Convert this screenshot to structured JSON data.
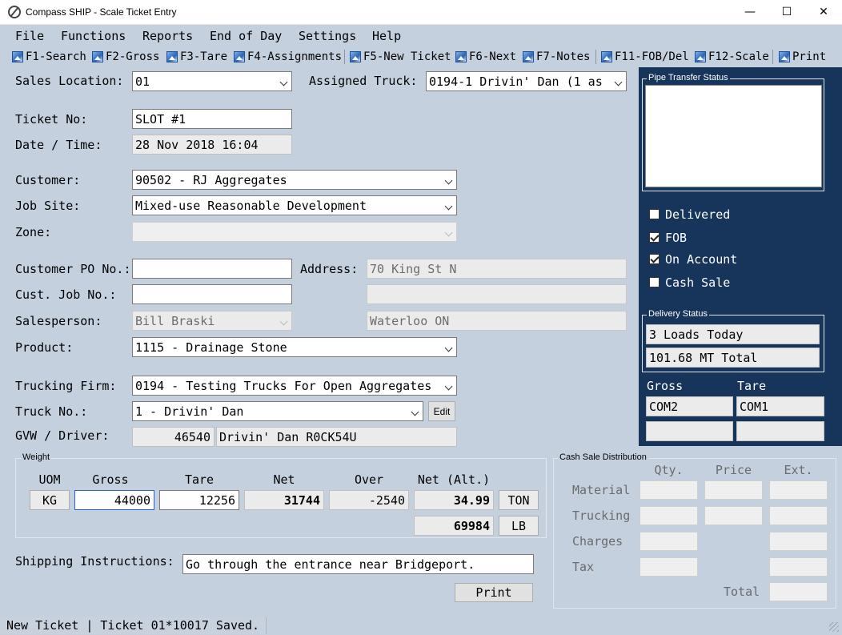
{
  "window": {
    "title": "Compass SHIP - Scale Ticket Entry",
    "minimize": "—",
    "maximize": "☐",
    "close": "✕"
  },
  "menu": [
    "File",
    "Functions",
    "Reports",
    "End of Day",
    "Settings",
    "Help"
  ],
  "toolbar": [
    "F1-Search",
    "F2-Gross",
    "F3-Tare",
    "F4-Assignments",
    "F5-New Ticket",
    "F6-Next",
    "F7-Notes",
    "F11-FOB/Del",
    "F12-Scale",
    "Print"
  ],
  "form": {
    "sales_location": {
      "label": "Sales Location:",
      "value": "01"
    },
    "assigned_truck": {
      "label": "Assigned Truck:",
      "value": "0194-1 Drivin' Dan  (1 as"
    },
    "ticket_no": {
      "label": "Ticket No:",
      "value": "SLOT #1"
    },
    "date_time": {
      "label": "Date / Time:",
      "value": "28 Nov 2018 16:04"
    },
    "customer": {
      "label": "Customer:",
      "value": "90502 - RJ Aggregates"
    },
    "job_site": {
      "label": "Job Site:",
      "value": "Mixed-use Reasonable Development"
    },
    "zone": {
      "label": "Zone:",
      "value": ""
    },
    "customer_po": {
      "label": "Customer PO No.:",
      "value": ""
    },
    "address": {
      "label": "Address:",
      "line1": "70 King St N",
      "line2": "",
      "line3": "Waterloo ON"
    },
    "cust_job_no": {
      "label": "Cust. Job No.:",
      "value": ""
    },
    "salesperson": {
      "label": "Salesperson:",
      "value": "Bill Braski"
    },
    "product": {
      "label": "Product:",
      "value": "1115 - Drainage Stone"
    },
    "trucking_firm": {
      "label": "Trucking Firm:",
      "value": "0194 - Testing Trucks For Open Aggregates"
    },
    "truck_no": {
      "label": "Truck No.:",
      "value": "1 - Drivin' Dan",
      "edit_label": "Edit"
    },
    "gvw_driver": {
      "label": "GVW / Driver:",
      "gvw": "46540",
      "driver": "Drivin' Dan R0CK54U"
    },
    "shipping_instructions": {
      "label": "Shipping Instructions:",
      "value": "Go through the entrance near Bridgeport."
    },
    "print_label": "Print"
  },
  "weight": {
    "title": "Weight",
    "headers": {
      "uom": "UOM",
      "gross": "Gross",
      "tare": "Tare",
      "net": "Net",
      "over": "Over",
      "net_alt": "Net (Alt.)"
    },
    "uom": "KG",
    "gross": "44000",
    "tare": "12256",
    "net": "31744",
    "over": "-2540",
    "net_alt_1": "34.99",
    "unit_1": "TON",
    "net_alt_2": "69984",
    "unit_2": "LB"
  },
  "cash_sale": {
    "title": "Cash Sale Distribution",
    "headers": {
      "qty": "Qty.",
      "price": "Price",
      "ext": "Ext."
    },
    "rows": [
      "Material",
      "Trucking",
      "Charges",
      "Tax"
    ],
    "total_label": "Total"
  },
  "right_panel": {
    "pipe_title": "Pipe Transfer Status",
    "checks": [
      {
        "label": "Delivered",
        "checked": false
      },
      {
        "label": "FOB",
        "checked": true
      },
      {
        "label": "On Account",
        "checked": true
      },
      {
        "label": "Cash Sale",
        "checked": false
      }
    ],
    "delivery_title": "Delivery Status",
    "loads_today": "3 Loads Today",
    "total": "101.68 MT Total",
    "gross_label": "Gross",
    "tare_label": "Tare",
    "gross_port": "COM2",
    "tare_port": "COM1"
  },
  "status": "New Ticket | Ticket 01*10017 Saved."
}
